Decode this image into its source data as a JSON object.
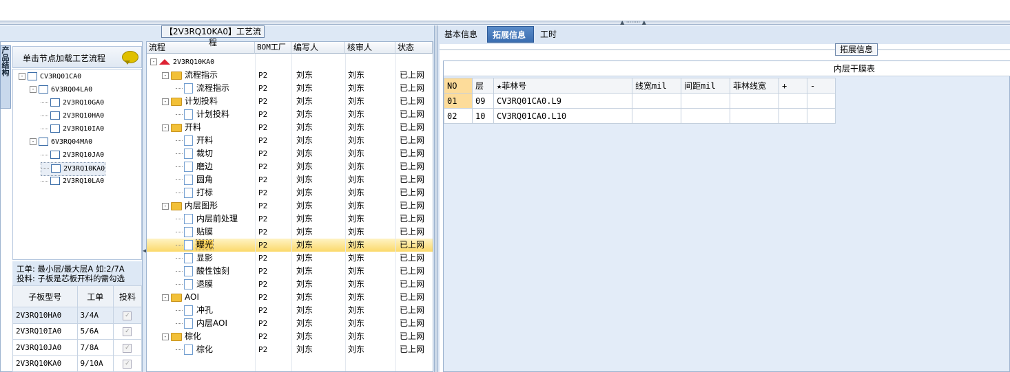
{
  "left_panel": {
    "vertical_tab": "产品结构",
    "header": "单击节点加载工艺流程",
    "tree": [
      {
        "label": "CV3RQ01CA0",
        "level": 0,
        "expander": "-"
      },
      {
        "label": "6V3RQ04LA0",
        "level": 1,
        "expander": "-"
      },
      {
        "label": "2V3RQ10GA0",
        "level": 2
      },
      {
        "label": "2V3RQ10HA0",
        "level": 2
      },
      {
        "label": "2V3RQ10IA0",
        "level": 2
      },
      {
        "label": "6V3RQ04MA0",
        "level": 1,
        "expander": "-"
      },
      {
        "label": "2V3RQ10JA0",
        "level": 2
      },
      {
        "label": "2V3RQ10KA0",
        "level": 2,
        "selected": true
      },
      {
        "label": "2V3RQ10LA0",
        "level": 2
      }
    ],
    "note_line1": "工单: 最小层/最大层A 如:2/7A",
    "note_line2": "投料: 子板是芯板开料的需勾选",
    "table_headers": [
      "子板型号",
      "工单",
      "投料"
    ],
    "table_rows": [
      {
        "model": "2V3RQ10HA0",
        "order": "3/4A",
        "check": "✓"
      },
      {
        "model": "2V3RQ10IA0",
        "order": "5/6A",
        "check": "✓"
      },
      {
        "model": "2V3RQ10JA0",
        "order": "7/8A",
        "check": "✓"
      },
      {
        "model": "2V3RQ10KA0",
        "order": "9/10A",
        "check": "✓"
      }
    ]
  },
  "middle_panel": {
    "title": "【2V3RQ10KA0】工艺流程",
    "headers": [
      "流程",
      "BOM工厂",
      "编写人",
      "核审人",
      "状态"
    ],
    "root": "2V3RQ10KA0",
    "rows": [
      {
        "name": "流程指示",
        "type": "folder",
        "factory": "P2",
        "writer": "刘东",
        "reviewer": "刘东",
        "status": "已上网"
      },
      {
        "name": "流程指示",
        "type": "doc",
        "factory": "P2",
        "writer": "刘东",
        "reviewer": "刘东",
        "status": "已上网"
      },
      {
        "name": "计划投料",
        "type": "folder",
        "factory": "P2",
        "writer": "刘东",
        "reviewer": "刘东",
        "status": "已上网"
      },
      {
        "name": "计划投料",
        "type": "doc",
        "factory": "P2",
        "writer": "刘东",
        "reviewer": "刘东",
        "status": "已上网"
      },
      {
        "name": "开料",
        "type": "folder",
        "factory": "P2",
        "writer": "刘东",
        "reviewer": "刘东",
        "status": "已上网"
      },
      {
        "name": "开料",
        "type": "doc",
        "factory": "P2",
        "writer": "刘东",
        "reviewer": "刘东",
        "status": "已上网"
      },
      {
        "name": "裁切",
        "type": "doc",
        "factory": "P2",
        "writer": "刘东",
        "reviewer": "刘东",
        "status": "已上网"
      },
      {
        "name": "磨边",
        "type": "doc",
        "factory": "P2",
        "writer": "刘东",
        "reviewer": "刘东",
        "status": "已上网"
      },
      {
        "name": "圆角",
        "type": "doc",
        "factory": "P2",
        "writer": "刘东",
        "reviewer": "刘东",
        "status": "已上网"
      },
      {
        "name": "打标",
        "type": "doc",
        "factory": "P2",
        "writer": "刘东",
        "reviewer": "刘东",
        "status": "已上网"
      },
      {
        "name": "内层图形",
        "type": "folder",
        "factory": "P2",
        "writer": "刘东",
        "reviewer": "刘东",
        "status": "已上网"
      },
      {
        "name": "内层前处理",
        "type": "doc",
        "factory": "P2",
        "writer": "刘东",
        "reviewer": "刘东",
        "status": "已上网"
      },
      {
        "name": "贴膜",
        "type": "doc",
        "factory": "P2",
        "writer": "刘东",
        "reviewer": "刘东",
        "status": "已上网"
      },
      {
        "name": "曝光",
        "type": "doc",
        "factory": "P2",
        "writer": "刘东",
        "reviewer": "刘东",
        "status": "已上网",
        "highlight": true
      },
      {
        "name": "显影",
        "type": "doc",
        "factory": "P2",
        "writer": "刘东",
        "reviewer": "刘东",
        "status": "已上网"
      },
      {
        "name": "酸性蚀刻",
        "type": "doc",
        "factory": "P2",
        "writer": "刘东",
        "reviewer": "刘东",
        "status": "已上网"
      },
      {
        "name": "退膜",
        "type": "doc",
        "factory": "P2",
        "writer": "刘东",
        "reviewer": "刘东",
        "status": "已上网"
      },
      {
        "name": "AOI",
        "type": "folder",
        "factory": "P2",
        "writer": "刘东",
        "reviewer": "刘东",
        "status": "已上网"
      },
      {
        "name": "冲孔",
        "type": "doc",
        "factory": "P2",
        "writer": "刘东",
        "reviewer": "刘东",
        "status": "已上网"
      },
      {
        "name": "内层AOI",
        "type": "doc",
        "factory": "P2",
        "writer": "刘东",
        "reviewer": "刘东",
        "status": "已上网"
      },
      {
        "name": "棕化",
        "type": "folder",
        "factory": "P2",
        "writer": "刘东",
        "reviewer": "刘东",
        "status": "已上网"
      },
      {
        "name": "棕化",
        "type": "doc",
        "factory": "P2",
        "writer": "刘东",
        "reviewer": "刘东",
        "status": "已上网"
      }
    ]
  },
  "right_panel": {
    "tabs": [
      {
        "label": "基本信息",
        "active": false
      },
      {
        "label": "拓展信息",
        "active": true
      },
      {
        "label": "工时",
        "active": false
      }
    ],
    "group_title": "拓展信息",
    "grid_title": "内层干膜表",
    "headers": [
      "NO",
      "层",
      "★菲林号",
      "线宽mil",
      "间距mil",
      "菲林线宽",
      "+",
      "-"
    ],
    "rows": [
      [
        "01",
        "09",
        "CV3RQ01CA0.L9",
        "",
        "",
        "",
        "",
        ""
      ],
      [
        "02",
        "10",
        "CV3RQ01CA0.L10",
        "",
        "",
        "",
        "",
        ""
      ]
    ]
  }
}
